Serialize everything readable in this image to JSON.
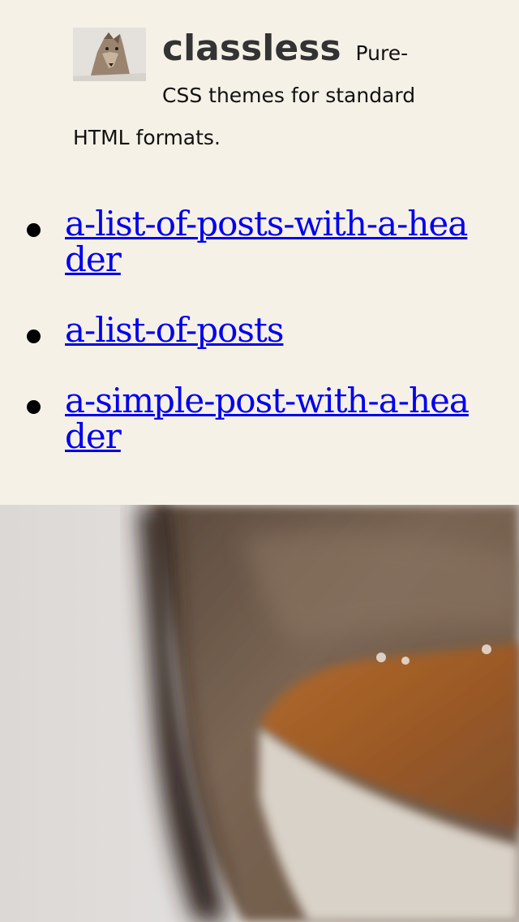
{
  "header": {
    "logo_icon": "coyote-photo-icon",
    "title": "classless",
    "tagline": "Pure-CSS themes for standard HTML formats."
  },
  "posts": [
    {
      "label": "a-list-of-posts-with-a-header"
    },
    {
      "label": "a-list-of-posts"
    },
    {
      "label": "a-simple-post-with-a-header"
    }
  ],
  "hero": {
    "icon": "coyote-fur-closeup-image"
  },
  "colors": {
    "background": "#f6f1e7",
    "link": "#0000ee",
    "title": "#333333"
  }
}
